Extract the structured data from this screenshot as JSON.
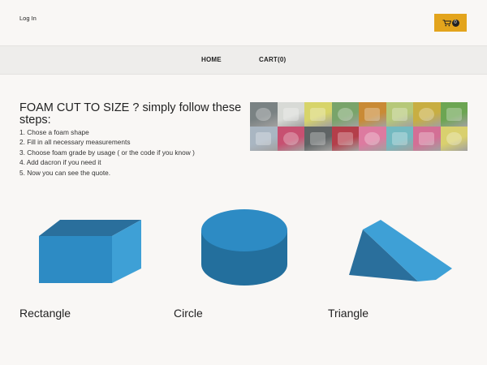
{
  "header": {
    "login_label": "Log In",
    "cart_count": "0",
    "cart_icon": "shopping-cart-icon",
    "accent_color": "#e3a41c"
  },
  "nav": {
    "home_label": "HOME",
    "cart_label": "CART(0)"
  },
  "intro": {
    "title": "FOAM CUT TO SIZE ? simply follow these steps:",
    "steps": [
      "1. Chose a foam shape",
      "2. Fill in all necessary measurements",
      "3. Choose foam grade by usage ( or the code if you know )",
      "4. Add dacron if you need it",
      "5. Now you can see the quote."
    ]
  },
  "collage": {
    "tiles": [
      {
        "name": "grey-channel-foam",
        "color": "#7a8283"
      },
      {
        "name": "white-block-foam",
        "color": "#d8dad6"
      },
      {
        "name": "yellow-profile-foam",
        "color": "#d7d46a"
      },
      {
        "name": "green-triangle-foam",
        "color": "#79a46a"
      },
      {
        "name": "orange-block-foam",
        "color": "#c98a35"
      },
      {
        "name": "lime-wedge-foam",
        "color": "#b6c879"
      },
      {
        "name": "yellow-twist-foam",
        "color": "#c8ae42"
      },
      {
        "name": "green-wave-foam",
        "color": "#6ca552"
      },
      {
        "name": "blue-sheet-foam",
        "color": "#a9b6c2"
      },
      {
        "name": "pink-egg-crate-foam",
        "color": "#c75071"
      },
      {
        "name": "grey-pad-foam",
        "color": "#5f6465"
      },
      {
        "name": "red-pyramid-foam",
        "color": "#b43e4a"
      },
      {
        "name": "pink-tube-foam",
        "color": "#dd7aa0"
      },
      {
        "name": "teal-block-foam",
        "color": "#73b9c0"
      },
      {
        "name": "pink-panel-foam",
        "color": "#d36f95"
      },
      {
        "name": "yellow-cushion-foam",
        "color": "#d9d06e"
      }
    ]
  },
  "shapes": [
    {
      "label": "Rectangle",
      "icon": "rectangle-foam-icon",
      "color": "#2d8bc4"
    },
    {
      "label": "Circle",
      "icon": "circle-foam-icon",
      "color": "#2d8bc4"
    },
    {
      "label": "Triangle",
      "icon": "triangle-foam-icon",
      "color": "#2d8bc4"
    }
  ]
}
